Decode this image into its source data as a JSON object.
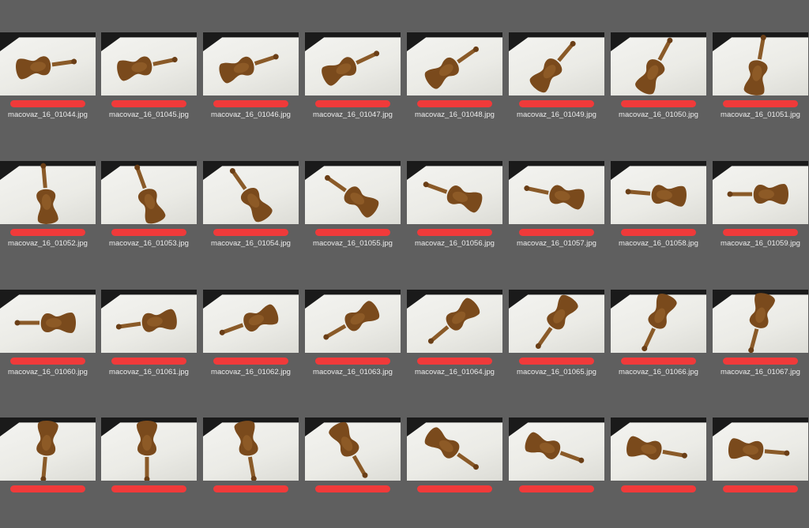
{
  "thumbnails": [
    {
      "filename": "macovaz_16_01044.jpg",
      "rotation": -8
    },
    {
      "filename": "macovaz_16_01045.jpg",
      "rotation": -12
    },
    {
      "filename": "macovaz_16_01046.jpg",
      "rotation": -18
    },
    {
      "filename": "macovaz_16_01047.jpg",
      "rotation": -25
    },
    {
      "filename": "macovaz_16_01048.jpg",
      "rotation": -35
    },
    {
      "filename": "macovaz_16_01049.jpg",
      "rotation": -50
    },
    {
      "filename": "macovaz_16_01050.jpg",
      "rotation": -62
    },
    {
      "filename": "macovaz_16_01051.jpg",
      "rotation": -80
    },
    {
      "filename": "macovaz_16_01052.jpg",
      "rotation": -95
    },
    {
      "filename": "macovaz_16_01053.jpg",
      "rotation": -110
    },
    {
      "filename": "macovaz_16_01054.jpg",
      "rotation": -125
    },
    {
      "filename": "macovaz_16_01055.jpg",
      "rotation": -145
    },
    {
      "filename": "macovaz_16_01056.jpg",
      "rotation": -160
    },
    {
      "filename": "macovaz_16_01057.jpg",
      "rotation": -168
    },
    {
      "filename": "macovaz_16_01058.jpg",
      "rotation": -175
    },
    {
      "filename": "macovaz_16_01059.jpg",
      "rotation": 180
    },
    {
      "filename": "macovaz_16_01060.jpg",
      "rotation": 180
    },
    {
      "filename": "macovaz_16_01061.jpg",
      "rotation": 172
    },
    {
      "filename": "macovaz_16_01062.jpg",
      "rotation": 160
    },
    {
      "filename": "macovaz_16_01063.jpg",
      "rotation": 150
    },
    {
      "filename": "macovaz_16_01064.jpg",
      "rotation": 140
    },
    {
      "filename": "macovaz_16_01065.jpg",
      "rotation": 125
    },
    {
      "filename": "macovaz_16_01066.jpg",
      "rotation": 115
    },
    {
      "filename": "macovaz_16_01067.jpg",
      "rotation": 105
    },
    {
      "filename": "",
      "rotation": 95
    },
    {
      "filename": "",
      "rotation": 90
    },
    {
      "filename": "",
      "rotation": 80
    },
    {
      "filename": "",
      "rotation": 60
    },
    {
      "filename": "",
      "rotation": 35
    },
    {
      "filename": "",
      "rotation": 20
    },
    {
      "filename": "",
      "rotation": 10
    },
    {
      "filename": "",
      "rotation": 5
    }
  ],
  "colors": {
    "background": "#5f5f5f",
    "label_bar": "#f03a3a",
    "violin": "#7a4a1c"
  }
}
